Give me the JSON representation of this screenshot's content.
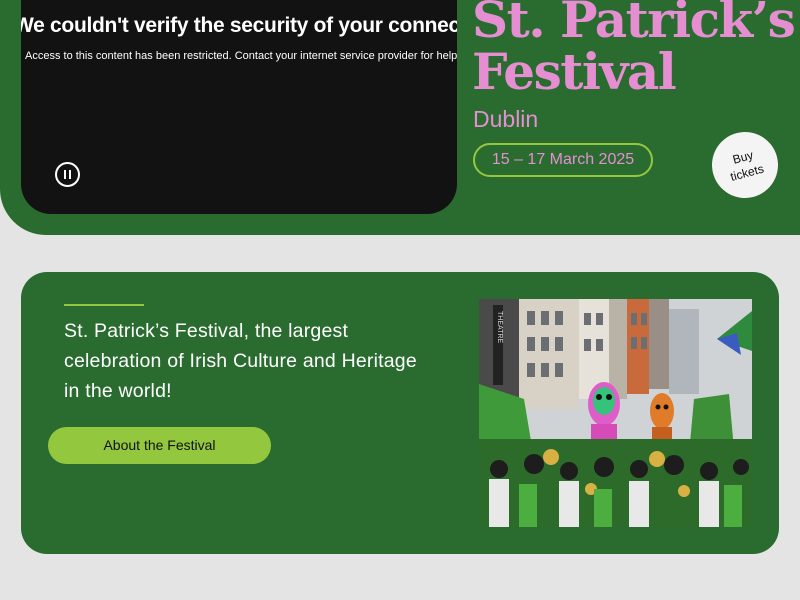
{
  "video": {
    "error_title": "We couldn't verify the security of your connection",
    "error_message": "Access to this content has been restricted. Contact your internet service provider for help.",
    "pause_icon": "pause-icon"
  },
  "hero": {
    "title_line1": "St. Patrick’s",
    "title_line2": "Festival",
    "city": "Dublin",
    "dates": "15 – 17 March 2025",
    "buy_label": "Buy tickets"
  },
  "about": {
    "text": "St. Patrick’s Festival, the largest celebration of Irish Culture and Heritage in the world!",
    "button_label": "About the Festival",
    "photo_sign": "THEATRE"
  },
  "colors": {
    "brand_green": "#2a6c2f",
    "accent_pink": "#e58fd2",
    "accent_lime": "#93c83e",
    "background": "#e4e4e4"
  }
}
